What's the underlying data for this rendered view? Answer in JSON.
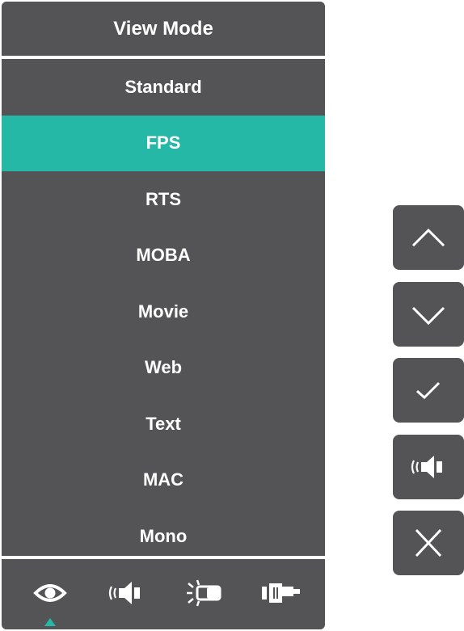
{
  "menu": {
    "title": "View Mode",
    "selected_index": 1,
    "items": [
      {
        "label": "Standard"
      },
      {
        "label": "FPS"
      },
      {
        "label": "RTS"
      },
      {
        "label": "MOBA"
      },
      {
        "label": "Movie"
      },
      {
        "label": "Web"
      },
      {
        "label": "Text"
      },
      {
        "label": "MAC"
      },
      {
        "label": "Mono"
      }
    ]
  },
  "bottom_tabs": [
    {
      "icon": "eye-icon",
      "active": true
    },
    {
      "icon": "speaker-icon",
      "active": false
    },
    {
      "icon": "brightness-icon",
      "active": false
    },
    {
      "icon": "input-connector-icon",
      "active": false
    }
  ],
  "side_buttons": [
    {
      "icon": "chevron-up-icon"
    },
    {
      "icon": "chevron-down-icon"
    },
    {
      "icon": "check-icon"
    },
    {
      "icon": "speaker-icon"
    },
    {
      "icon": "close-icon"
    }
  ],
  "colors": {
    "panel": "#545456",
    "selected": "#26b8a6",
    "text": "#ffffff",
    "indicator": "#26b8a6"
  }
}
